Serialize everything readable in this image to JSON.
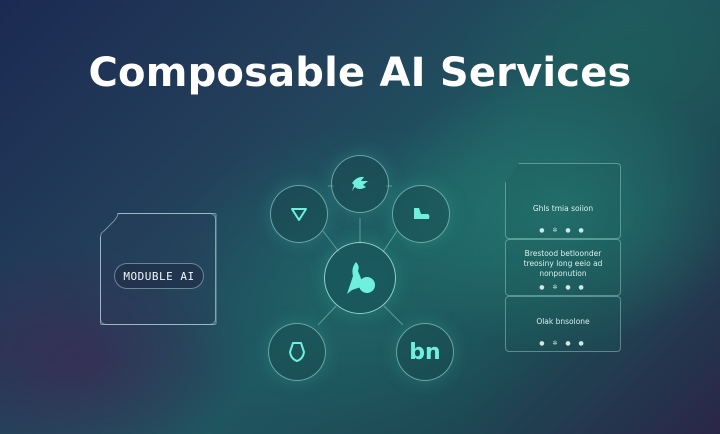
{
  "title": "Composable AI Services",
  "module_label": "MODUBLE AI",
  "node_text_bottom_right": "bn",
  "panels": [
    {
      "text": "Ghls tmia soiion",
      "dots": "● ✲ ● ●"
    },
    {
      "text": "Brestood betloonder treosiny long eeio ad nonponution",
      "dots": "● ✲ ● ●"
    },
    {
      "text": "Olak bnsolone",
      "dots": "● ✲ ● ●"
    }
  ],
  "colors": {
    "accent": "#6ff0de",
    "title": "#ffffff"
  },
  "icons": {
    "top": "leaf-arrow-icon",
    "top_left": "funnel-icon",
    "top_right": "boot-icon",
    "center": "figure-shapes-icon",
    "bottom_left": "shield-icon",
    "bottom_right": "letters-bn-icon"
  }
}
